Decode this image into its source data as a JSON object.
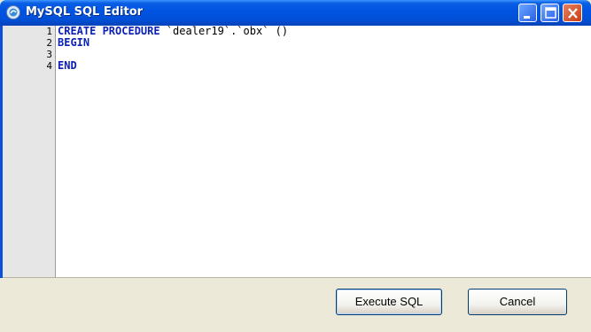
{
  "window": {
    "title": "MySQL SQL Editor",
    "icon": "mysql-app-icon",
    "controls": [
      "minimize-icon",
      "maximize-icon",
      "close-icon"
    ]
  },
  "editor": {
    "lines": [
      {
        "number": "1",
        "tokens": [
          {
            "text": "CREATE PROCEDURE",
            "kind": "keyword"
          },
          {
            "text": " `dealer19`.`obx` ()",
            "kind": "plain"
          }
        ]
      },
      {
        "number": "2",
        "tokens": [
          {
            "text": "BEGIN",
            "kind": "keyword"
          }
        ]
      },
      {
        "number": "3",
        "tokens": []
      },
      {
        "number": "4",
        "tokens": [
          {
            "text": "END",
            "kind": "keyword"
          }
        ]
      }
    ]
  },
  "buttons": {
    "execute_label": "Execute SQL",
    "cancel_label": "Cancel"
  },
  "colors": {
    "titlebar": "#0054e3",
    "keyword": "#0a1fb5",
    "gutter": "#e6e6e6",
    "close_button": "#c73d17"
  }
}
